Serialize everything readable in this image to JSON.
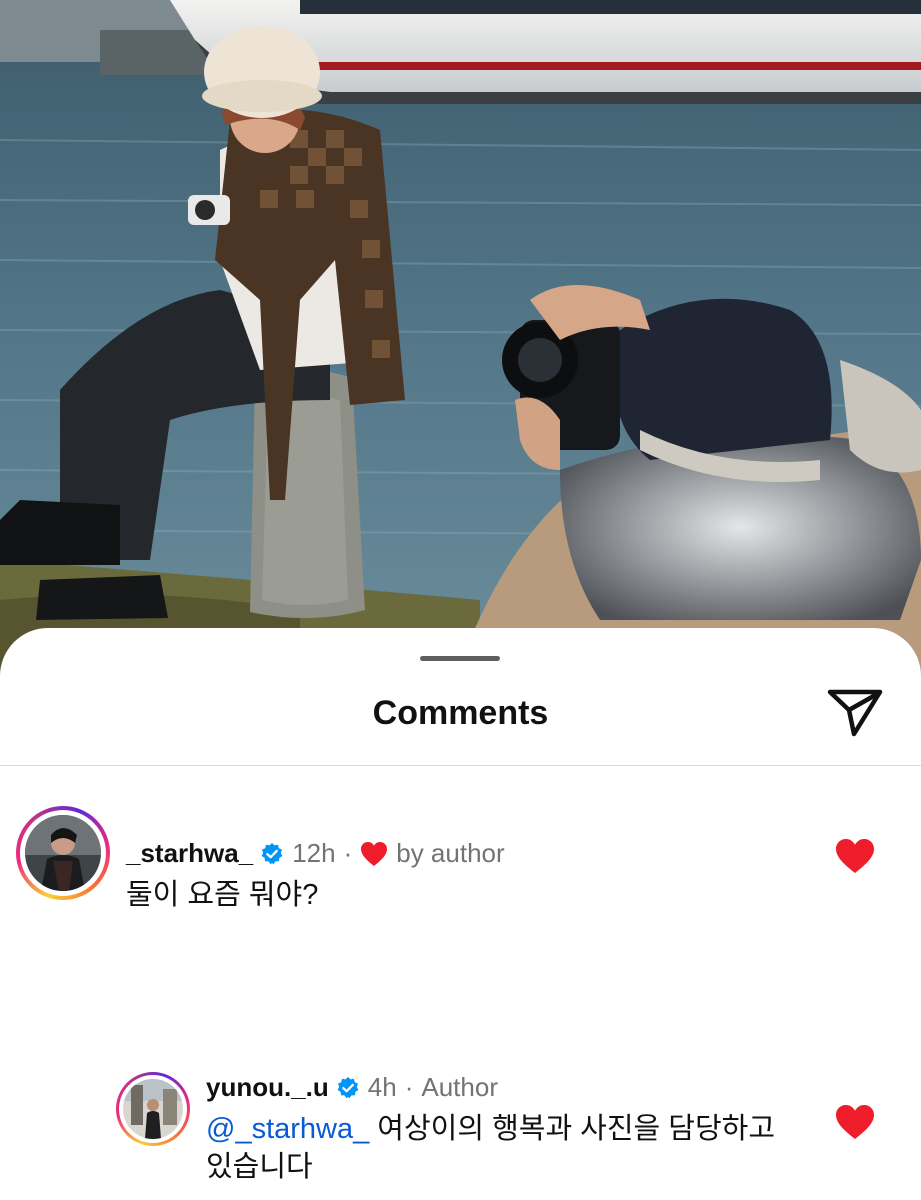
{
  "sheet": {
    "title": "Comments"
  },
  "icons": {
    "share": "paper-plane-icon",
    "verified": "verified-badge-icon",
    "author_like": "red-heart-icon",
    "like": "red-heart-icon"
  },
  "colors": {
    "heart": "#ef1d2c",
    "verified": "#0095f6",
    "mention": "#0a5ad6",
    "secondary_text": "#737373"
  },
  "comments": [
    {
      "username": "_starhwa_",
      "verified": true,
      "time": "12h",
      "separator": "·",
      "liked_by_author_label": "by author",
      "text": "둘이 요즘 뭐야?",
      "liked": true
    }
  ],
  "replies": [
    {
      "username": "yunou._.u",
      "verified": true,
      "time": "4h",
      "separator": "·",
      "author_label": "Author",
      "mention": "@_starhwa_",
      "text_line1": " 여상이의 행복과 사진을 담당하고",
      "text_line2": "있습니다",
      "liked": true
    }
  ]
}
